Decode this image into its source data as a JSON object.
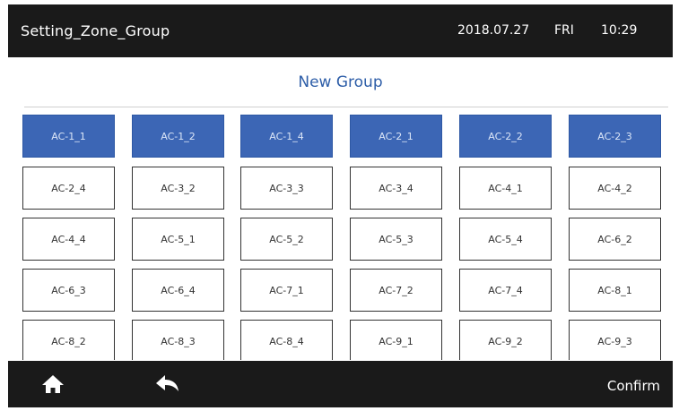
{
  "header": {
    "title": "Setting_Zone_Group",
    "date": "2018.07.27",
    "weekday": "FRI",
    "time": "10:29"
  },
  "group_title": "New Group",
  "units": [
    {
      "label": "AC-1_1",
      "selected": true
    },
    {
      "label": "AC-1_2",
      "selected": true
    },
    {
      "label": "AC-1_4",
      "selected": true
    },
    {
      "label": "AC-2_1",
      "selected": true
    },
    {
      "label": "AC-2_2",
      "selected": true
    },
    {
      "label": "AC-2_3",
      "selected": true
    },
    {
      "label": "AC-2_4",
      "selected": false
    },
    {
      "label": "AC-3_2",
      "selected": false
    },
    {
      "label": "AC-3_3",
      "selected": false
    },
    {
      "label": "AC-3_4",
      "selected": false
    },
    {
      "label": "AC-4_1",
      "selected": false
    },
    {
      "label": "AC-4_2",
      "selected": false
    },
    {
      "label": "AC-4_4",
      "selected": false
    },
    {
      "label": "AC-5_1",
      "selected": false
    },
    {
      "label": "AC-5_2",
      "selected": false
    },
    {
      "label": "AC-5_3",
      "selected": false
    },
    {
      "label": "AC-5_4",
      "selected": false
    },
    {
      "label": "AC-6_2",
      "selected": false
    },
    {
      "label": "AC-6_3",
      "selected": false
    },
    {
      "label": "AC-6_4",
      "selected": false
    },
    {
      "label": "AC-7_1",
      "selected": false
    },
    {
      "label": "AC-7_2",
      "selected": false
    },
    {
      "label": "AC-7_4",
      "selected": false
    },
    {
      "label": "AC-8_1",
      "selected": false
    },
    {
      "label": "AC-8_2",
      "selected": false
    },
    {
      "label": "AC-8_3",
      "selected": false
    },
    {
      "label": "AC-8_4",
      "selected": false
    },
    {
      "label": "AC-9_1",
      "selected": false
    },
    {
      "label": "AC-9_2",
      "selected": false
    },
    {
      "label": "AC-9_3",
      "selected": false
    }
  ],
  "footer": {
    "home_icon": "home-icon",
    "back_icon": "back-arrow-icon",
    "confirm_label": "Confirm"
  },
  "colors": {
    "bar_bg": "#1a1a1a",
    "accent_blue": "#3c66b5",
    "title_blue": "#2e5ea8"
  }
}
